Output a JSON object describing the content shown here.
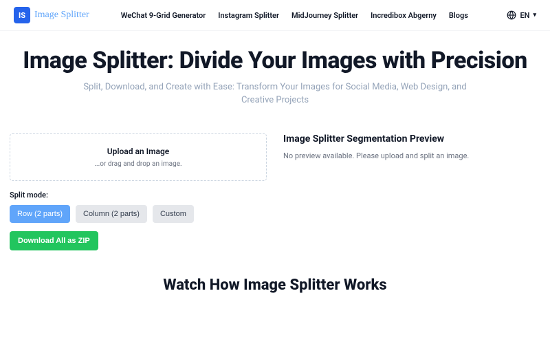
{
  "logo": {
    "badge": "IS",
    "text": "Image Splitter"
  },
  "nav": {
    "items": [
      "WeChat 9-Grid Generator",
      "Instagram Splitter",
      "MidJourney Splitter",
      "Incredibox Abgerny",
      "Blogs"
    ]
  },
  "lang": {
    "label": "EN"
  },
  "hero": {
    "title": "Image Splitter: Divide Your Images with Precision",
    "subtitle": "Split, Download, and Create with Ease: Transform Your Images for Social Media, Web Design, and Creative Projects"
  },
  "upload": {
    "title": "Upload an Image",
    "hint": "...or drag and drop an image."
  },
  "split_mode": {
    "label": "Split mode:",
    "options": [
      "Row (2 parts)",
      "Column (2 parts)",
      "Custom"
    ]
  },
  "download": {
    "label": "Download All as ZIP"
  },
  "preview": {
    "title": "Image Splitter Segmentation Preview",
    "empty": "No preview available. Please upload and split an image."
  },
  "secondary": {
    "title": "Watch How Image Splitter Works"
  }
}
